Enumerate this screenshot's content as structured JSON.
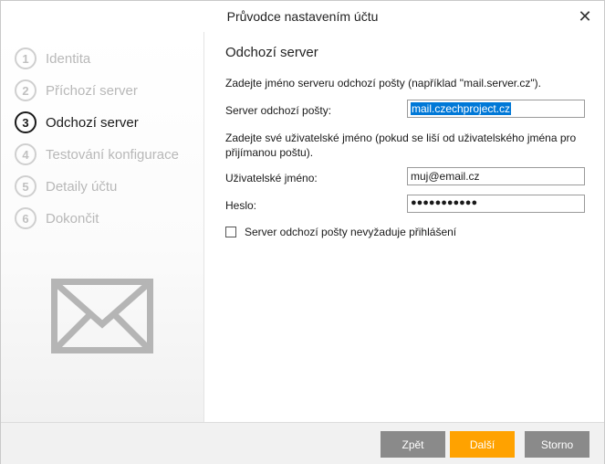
{
  "window": {
    "title": "Průvodce nastavením účtu"
  },
  "steps": [
    {
      "num": "1",
      "label": "Identita"
    },
    {
      "num": "2",
      "label": "Příchozí server"
    },
    {
      "num": "3",
      "label": "Odchozí server"
    },
    {
      "num": "4",
      "label": "Testování konfigurace"
    },
    {
      "num": "5",
      "label": "Detaily účtu"
    },
    {
      "num": "6",
      "label": "Dokončit"
    }
  ],
  "active_step": "3",
  "main": {
    "heading": "Odchozí server",
    "instruction_server": "Zadejte jméno serveru odchozí pošty (například \"mail.server.cz\").",
    "server_label": "Server odchozí pošty:",
    "server_value": "mail.czechproject.cz",
    "instruction_user": "Zadejte své uživatelské jméno (pokud se liší od uživatelského jména pro přijímanou poštu).",
    "username_label": "Uživatelské jméno:",
    "username_value": "muj@email.cz",
    "password_label": "Heslo:",
    "password_value": "●●●●●●●●●●●",
    "no_auth_label": "Server odchozí pošty nevyžaduje přihlášení",
    "no_auth_checked": false
  },
  "footer": {
    "back_label": "Zpět",
    "next_label": "Další",
    "cancel_label": "Storno"
  },
  "colors": {
    "accent": "#ffa200",
    "button_gray": "#8a8a8a",
    "selection": "#0078d7"
  }
}
